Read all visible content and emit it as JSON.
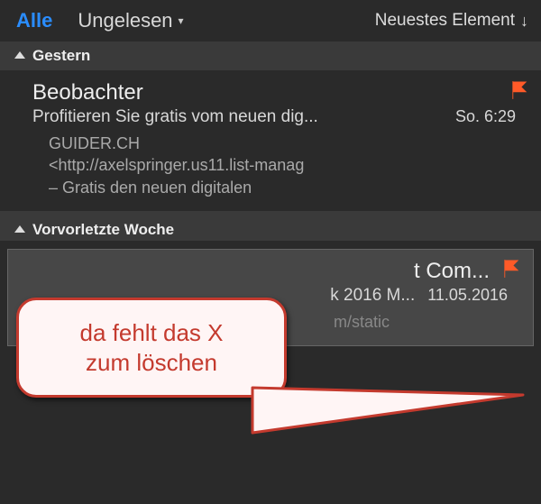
{
  "tabs": {
    "all": "Alle",
    "unread": "Ungelesen"
  },
  "sort": {
    "label": "Neuestes Element"
  },
  "groups": {
    "g0": {
      "label": "Gestern"
    },
    "g1": {
      "label": "Vorvorletzte Woche"
    }
  },
  "messages": {
    "m0": {
      "sender": "Beobachter",
      "subject": "Profitieren Sie gratis vom neuen dig...",
      "timestamp": "So. 6:29",
      "preview_l1": "GUIDER.CH",
      "preview_l2": "<http://axelspringer.us11.list-manag",
      "preview_l3": "– Gratis den neuen digitalen"
    },
    "m1": {
      "sender": "t Com...",
      "subject": "k 2016 M...",
      "timestamp": "11.05.2016",
      "preview_l1": "m/static"
    }
  },
  "annotation": {
    "line1": "da fehlt das X",
    "line2": "zum löschen"
  }
}
